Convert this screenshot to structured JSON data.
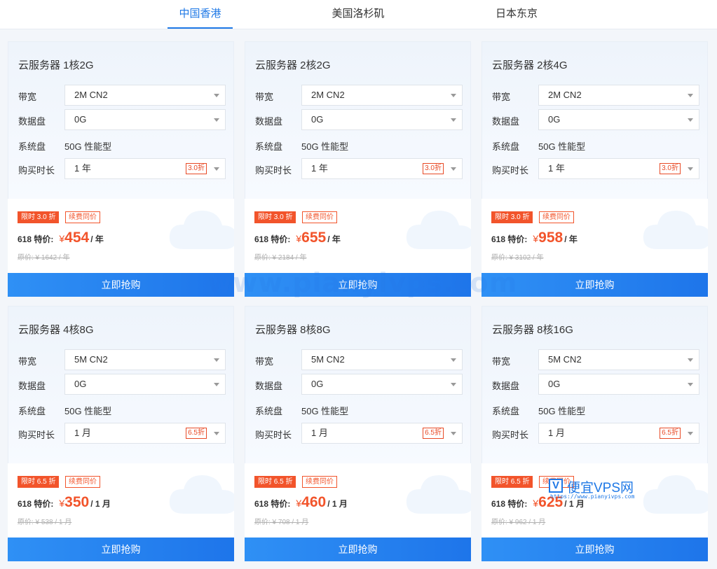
{
  "tabs": [
    {
      "label": "中国香港",
      "active": true
    },
    {
      "label": "美国洛杉矶",
      "active": false
    },
    {
      "label": "日本东京",
      "active": false
    }
  ],
  "labels": {
    "bandwidth": "带宽",
    "data_disk": "数据盘",
    "system_disk": "系统盘",
    "duration": "购买时长",
    "renew_same": "续费同价",
    "special_price": "618 特价:",
    "currency": "¥",
    "buy_button": "立即抢购"
  },
  "cards": [
    {
      "title": "云服务器 1核2G",
      "bandwidth": "2M CN2",
      "data_disk": "0G",
      "system_disk": "50G 性能型",
      "duration": "1 年",
      "discount_tag": "3.0折",
      "badge": "限时 3.0 折",
      "price": "454",
      "unit": "/ 年",
      "original": "原价: ¥ 1642 / 年"
    },
    {
      "title": "云服务器 2核2G",
      "bandwidth": "2M CN2",
      "data_disk": "0G",
      "system_disk": "50G 性能型",
      "duration": "1 年",
      "discount_tag": "3.0折",
      "badge": "限时 3.0 折",
      "price": "655",
      "unit": "/ 年",
      "original": "原价: ¥ 2184 / 年"
    },
    {
      "title": "云服务器 2核4G",
      "bandwidth": "2M CN2",
      "data_disk": "0G",
      "system_disk": "50G 性能型",
      "duration": "1 年",
      "discount_tag": "3.0折",
      "badge": "限时 3.0 折",
      "price": "958",
      "unit": "/ 年",
      "original": "原价: ¥ 3102 / 年"
    },
    {
      "title": "云服务器 4核8G",
      "bandwidth": "5M CN2",
      "data_disk": "0G",
      "system_disk": "50G 性能型",
      "duration": "1 月",
      "discount_tag": "6.5折",
      "badge": "限时 6.5 折",
      "price": "350",
      "unit": "/ 1 月",
      "original": "原价: ¥ 538 / 1 月"
    },
    {
      "title": "云服务器 8核8G",
      "bandwidth": "5M CN2",
      "data_disk": "0G",
      "system_disk": "50G 性能型",
      "duration": "1 月",
      "discount_tag": "6.5折",
      "badge": "限时 6.5 折",
      "price": "460",
      "unit": "/ 1 月",
      "original": "原价: ¥ 708 / 1 月"
    },
    {
      "title": "云服务器 8核16G",
      "bandwidth": "5M CN2",
      "data_disk": "0G",
      "system_disk": "50G 性能型",
      "duration": "1 月",
      "discount_tag": "6.5折",
      "badge": "限时 6.5 折",
      "price": "625",
      "unit": "/ 1 月",
      "original": "原价: ¥ 962 / 1 月"
    }
  ],
  "watermark": {
    "text": "www.pianyivps.com",
    "logo_letter": "V",
    "logo_name": "便宜VPS网",
    "logo_url": "https://www.pianyivps.com"
  },
  "colors": {
    "accent_blue": "#1e78e6",
    "price_red": "#f2542b",
    "button_blue": "#2f90f5"
  }
}
